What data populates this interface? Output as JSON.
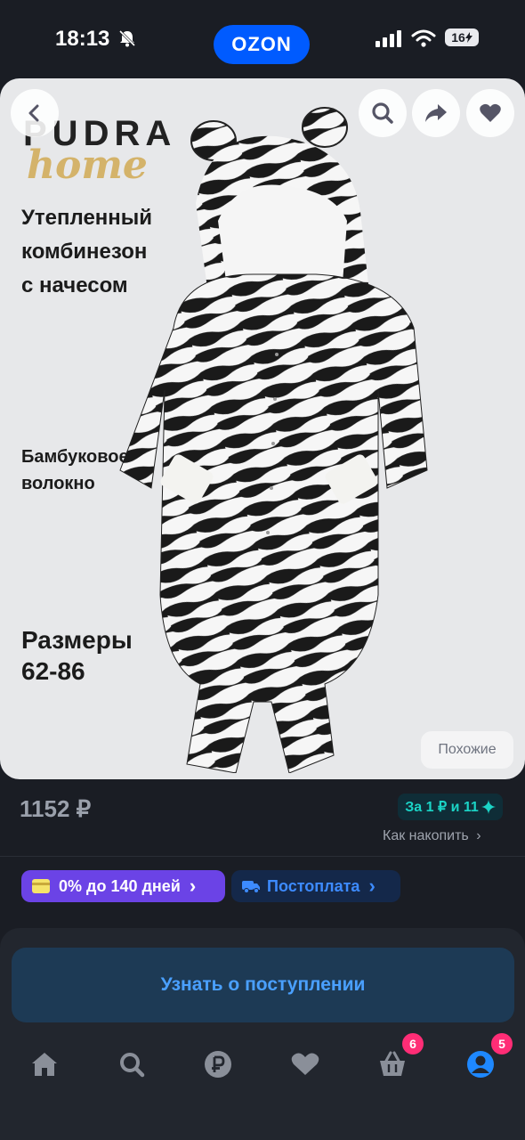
{
  "status_bar": {
    "time": "18:13",
    "battery": "16"
  },
  "header": {
    "logo": "OZON"
  },
  "hero": {
    "brand_top": "PUDRA",
    "brand_bottom": "home",
    "tagline_lines": [
      "Утепленный",
      "комбинезон",
      "с начесом"
    ],
    "feature_lines": [
      "Бамбуковое",
      "волокно"
    ],
    "sizes_title": "Размеры",
    "sizes_value": "62-86",
    "similar_button": "Похожие",
    "icons": [
      "back-icon",
      "search-icon",
      "share-icon",
      "heart-icon"
    ]
  },
  "product": {
    "price": "1152 ₽",
    "points_badge": "За 1 ₽ и 11",
    "accumulate_link": "Как накопить"
  },
  "payment_chips": [
    {
      "label": "0% до 140 дней",
      "icon": "card-icon",
      "color": "#6b43e6"
    },
    {
      "label": "Постоплата",
      "icon": "truck-icon",
      "color": "#3d8bff"
    }
  ],
  "notify_button": "Узнать о поступлении",
  "tabbar": {
    "items": [
      {
        "name": "home",
        "icon": "home-icon"
      },
      {
        "name": "search",
        "icon": "search-icon"
      },
      {
        "name": "ruble",
        "icon": "ruble-icon"
      },
      {
        "name": "favorites",
        "icon": "heart-icon"
      },
      {
        "name": "cart",
        "icon": "basket-icon",
        "badge": "6"
      },
      {
        "name": "profile",
        "icon": "profile-icon",
        "badge": "5"
      }
    ]
  },
  "colors": {
    "accent_blue": "#005bff",
    "badge_pink": "#ff2d76",
    "points_teal": "#1bd4c6"
  }
}
